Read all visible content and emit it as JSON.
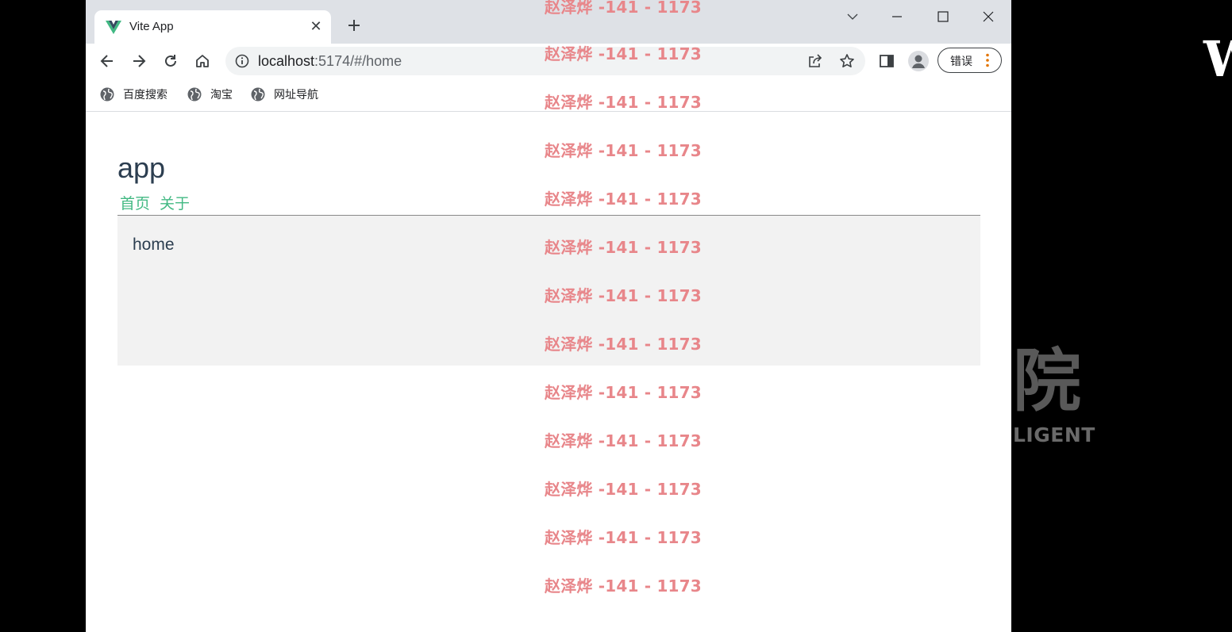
{
  "background": {
    "letter_w": "W",
    "char_yuan": "院",
    "text_ligent": "LIGENT"
  },
  "browser": {
    "tab": {
      "title": "Vite App",
      "favicon": "vue-logo-icon"
    },
    "omnibox": {
      "url_host": "localhost",
      "url_rest": ":5174/#/home"
    },
    "error_button_label": "错误",
    "bookmarks": [
      {
        "label": "百度搜索",
        "icon": "globe-icon"
      },
      {
        "label": "淘宝",
        "icon": "globe-icon"
      },
      {
        "label": "网址导航",
        "icon": "globe-icon"
      }
    ]
  },
  "page": {
    "title": "app",
    "nav": {
      "home_link": "首页",
      "about_link": "关于"
    },
    "view_text": "home"
  },
  "watermark": {
    "text": "赵泽烨 -141 - 1173",
    "color": "#e8868a"
  },
  "colors": {
    "link_green": "#42b983",
    "heading": "#2c3e50",
    "view_bg": "#f2f2f2"
  }
}
